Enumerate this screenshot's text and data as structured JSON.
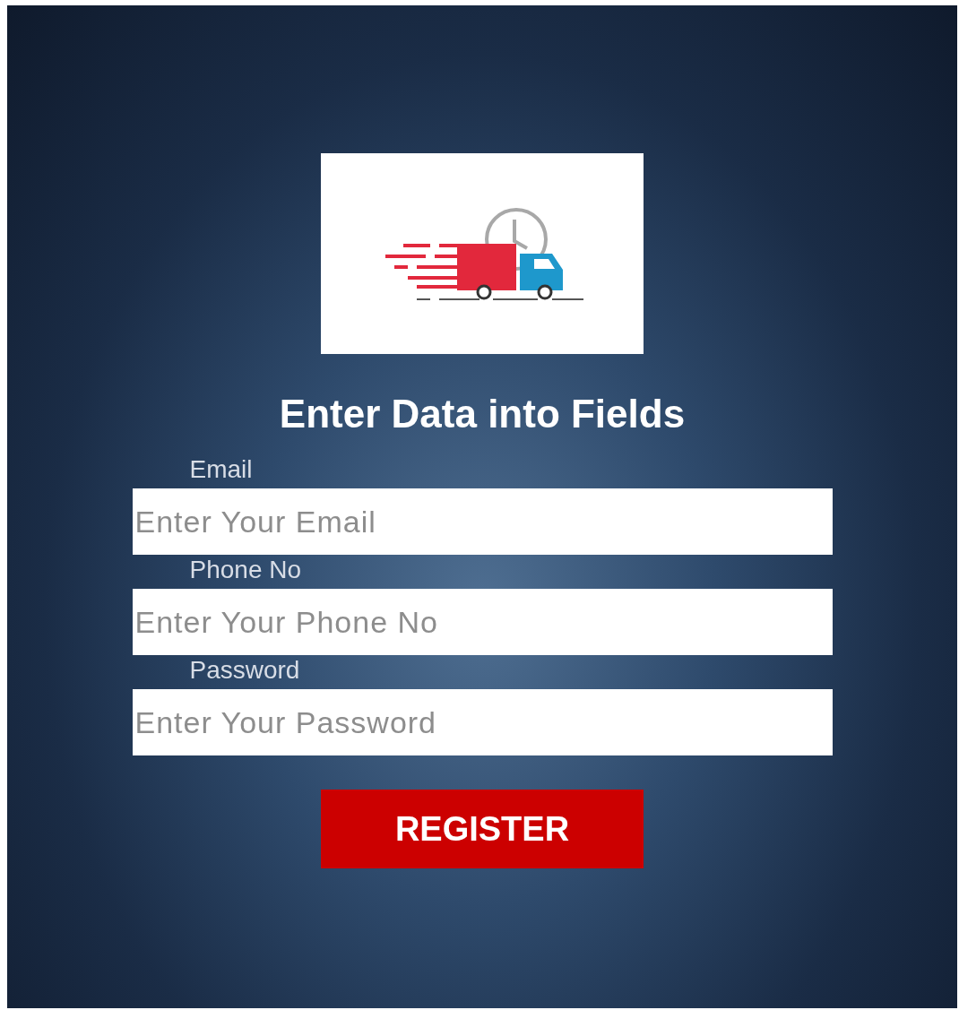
{
  "title": "Enter Data into Fields",
  "fields": [
    {
      "label": "Email",
      "placeholder": "Enter Your Email"
    },
    {
      "label": "Phone No",
      "placeholder": "Enter Your Phone No"
    },
    {
      "label": "Password",
      "placeholder": "Enter Your Password"
    }
  ],
  "button": "REGISTER"
}
